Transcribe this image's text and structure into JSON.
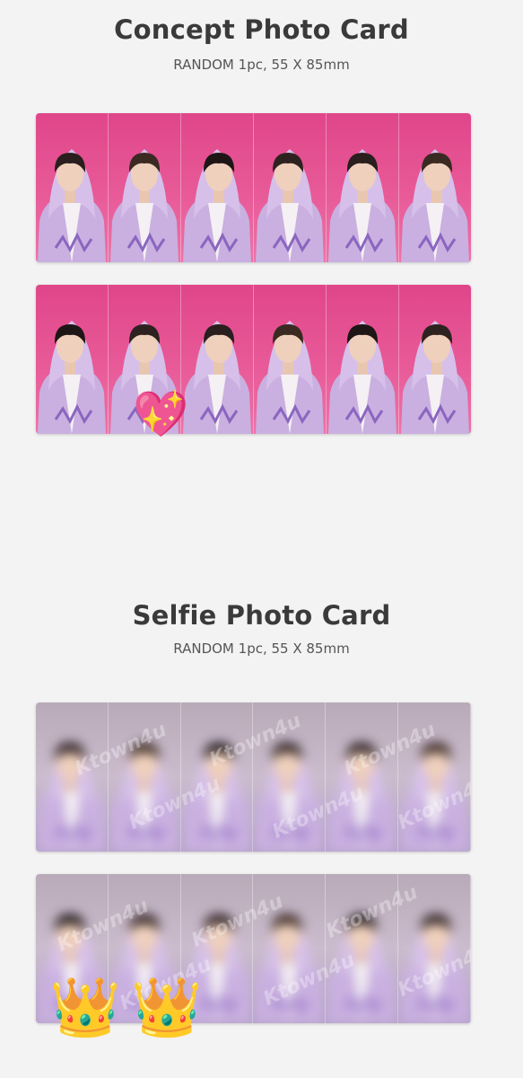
{
  "concept": {
    "title": "Concept Photo Card",
    "subtitle": "RANDOM 1pc, 55 X 85mm"
  },
  "selfie": {
    "title": "Selfie Photo Card",
    "subtitle": "RANDOM 1pc, 55 X 85mm"
  },
  "watermark": "Ktown4u",
  "stickers": {
    "heart": "💖",
    "crown": "👑"
  },
  "colors": {
    "background": "#f3f3f3",
    "concept_card": "#e0468a",
    "hoodie": "#c9b0e0",
    "title_text": "#3a3a3a"
  }
}
